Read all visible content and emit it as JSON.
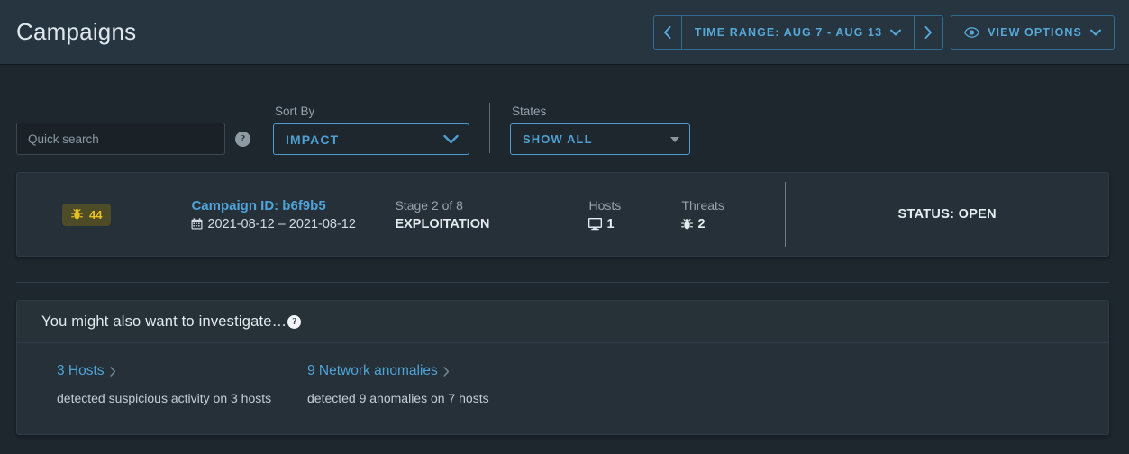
{
  "header": {
    "title": "Campaigns",
    "time_range_prev_icon": "chevron-left-icon",
    "time_range_label": "TIME RANGE: AUG 7 - AUG 13",
    "time_range_next_icon": "chevron-right-icon",
    "view_options_label": "VIEW OPTIONS",
    "view_options_icon": "eye-icon"
  },
  "filters": {
    "search_placeholder": "Quick search",
    "search_value": "",
    "search_help_icon": "?",
    "sort_by_label": "Sort By",
    "sort_by_value": "IMPACT",
    "states_label": "States",
    "states_value": "SHOW ALL"
  },
  "campaign": {
    "impact_icon": "bug-icon",
    "impact_score": "44",
    "id_label": "Campaign ID: b6f9b5",
    "date_icon": "calendar-icon",
    "dates": "2021-08-12 – 2021-08-12",
    "stage_head": "Stage 2 of 8",
    "stage_value": "EXPLOITATION",
    "hosts_head": "Hosts",
    "hosts_icon": "monitor-icon",
    "hosts_value": "1",
    "threats_head": "Threats",
    "threats_icon": "bug-icon",
    "threats_value": "2",
    "status": "STATUS: OPEN"
  },
  "investigate": {
    "title": "You might also want to investigate…",
    "help_icon": "?",
    "items": [
      {
        "link": "3 Hosts",
        "chevron": "chevron-right-icon",
        "description": "detected suspicious activity on 3 hosts"
      },
      {
        "link": "9 Network anomalies",
        "chevron": "chevron-right-icon",
        "description": "detected 9 anomalies on 7 hosts"
      }
    ]
  },
  "colors": {
    "page_bg": "#1e262e",
    "topbar_bg": "#263540",
    "card_bg": "#253038",
    "accent_blue": "#4fa3d8",
    "badge_bg": "#4d4c27",
    "badge_fg": "#e9c024"
  }
}
